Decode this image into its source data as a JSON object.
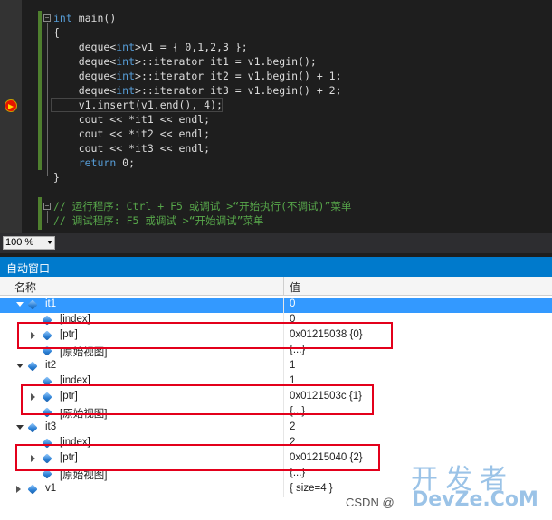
{
  "editor": {
    "lines": [
      {
        "parts": [
          {
            "t": "int",
            "c": "kw"
          },
          {
            "t": " main()",
            "c": ""
          }
        ]
      },
      {
        "parts": [
          {
            "t": "{",
            "c": ""
          }
        ]
      },
      {
        "parts": [
          {
            "t": "    deque<",
            "c": "kw2"
          },
          {
            "t": "int",
            "c": "kw"
          },
          {
            "t": ">v1 = { 0,1,2,3 };",
            "c": ""
          }
        ]
      },
      {
        "parts": [
          {
            "t": "    deque<",
            "c": "kw2"
          },
          {
            "t": "int",
            "c": "kw"
          },
          {
            "t": ">::iterator it1 = v1.begin();",
            "c": ""
          }
        ]
      },
      {
        "parts": [
          {
            "t": "    deque<",
            "c": "kw2"
          },
          {
            "t": "int",
            "c": "kw"
          },
          {
            "t": ">::iterator it2 = v1.begin() + 1;",
            "c": ""
          }
        ]
      },
      {
        "parts": [
          {
            "t": "    deque<",
            "c": "kw2"
          },
          {
            "t": "int",
            "c": "kw"
          },
          {
            "t": ">::iterator it3 = v1.begin() + 2;",
            "c": ""
          }
        ]
      },
      {
        "parts": [
          {
            "t": "    v1.insert(v1.end(), 4);",
            "c": ""
          }
        ]
      },
      {
        "parts": [
          {
            "t": "    cout << *it1 << endl;",
            "c": ""
          }
        ]
      },
      {
        "parts": [
          {
            "t": "    cout << *it2 << endl;",
            "c": ""
          }
        ]
      },
      {
        "parts": [
          {
            "t": "    cout << *it3 << endl;",
            "c": ""
          }
        ]
      },
      {
        "parts": [
          {
            "t": "    ",
            "c": ""
          },
          {
            "t": "return",
            "c": "kw"
          },
          {
            "t": " 0;",
            "c": ""
          }
        ]
      },
      {
        "parts": [
          {
            "t": "}",
            "c": ""
          }
        ]
      },
      {
        "parts": [
          {
            "t": "",
            "c": ""
          }
        ]
      },
      {
        "parts": [
          {
            "t": "// 运行程序: Ctrl + F5 或调试 >“开始执行(不调试)”菜单",
            "c": "cm"
          }
        ]
      },
      {
        "parts": [
          {
            "t": "// 调试程序: F5 或调试 >“开始调试”菜单",
            "c": "cm"
          }
        ]
      }
    ]
  },
  "zoom": {
    "value": "100 %"
  },
  "autos": {
    "title": "自动窗口",
    "columns": {
      "name": "名称",
      "value": "值"
    },
    "rows": [
      {
        "indent": 0,
        "expander": "exp",
        "name": "it1",
        "value": "0",
        "selected": true
      },
      {
        "indent": 1,
        "expander": "none",
        "name": "[index]",
        "value": "0"
      },
      {
        "indent": 1,
        "expander": "col",
        "name": "[ptr]",
        "value": "0x01215038 {0}"
      },
      {
        "indent": 1,
        "expander": "none",
        "name": "[原始视图]",
        "value": "{...}"
      },
      {
        "indent": 0,
        "expander": "exp",
        "name": "it2",
        "value": "1"
      },
      {
        "indent": 1,
        "expander": "none",
        "name": "[index]",
        "value": "1"
      },
      {
        "indent": 1,
        "expander": "col",
        "name": "[ptr]",
        "value": "0x0121503c {1}"
      },
      {
        "indent": 1,
        "expander": "none",
        "name": "[原始视图]",
        "value": "{...}"
      },
      {
        "indent": 0,
        "expander": "exp",
        "name": "it3",
        "value": "2"
      },
      {
        "indent": 1,
        "expander": "none",
        "name": "[index]",
        "value": "2"
      },
      {
        "indent": 1,
        "expander": "col",
        "name": "[ptr]",
        "value": "0x01215040 {2}"
      },
      {
        "indent": 1,
        "expander": "none",
        "name": "[原始视图]",
        "value": "{...}"
      },
      {
        "indent": 0,
        "expander": "col",
        "name": "v1",
        "value": "{ size=4 }"
      }
    ]
  },
  "watermark": {
    "line1": "开发者",
    "line2": "DevZe.CoM",
    "source": "CSDN @"
  },
  "colors": {
    "accent": "#007acc",
    "selection": "#3399ff",
    "highlight_box": "#e3001b",
    "keyword": "#569cd6",
    "comment": "#57a64a"
  }
}
